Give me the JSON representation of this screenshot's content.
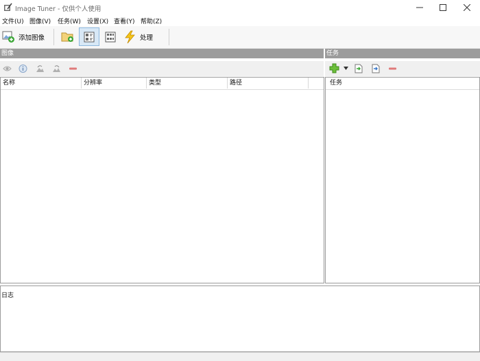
{
  "window": {
    "title": "Image Tuner - 仅供个人使用",
    "controls": [
      "minimize",
      "maximize",
      "close"
    ]
  },
  "menu": [
    "文件(U)",
    "图像(V)",
    "任务(W)",
    "设置(X)",
    "查看(Y)",
    "帮助(Z)"
  ],
  "toolbar": {
    "add_images_label": "添加图像",
    "add_folder_icon": "folder-add-icon",
    "view_details_icon": "view-details-icon",
    "view_thumbnails_icon": "view-thumbnails-icon",
    "process_label": "处理"
  },
  "images_panel": {
    "title": "图像",
    "tools": [
      "eye-icon",
      "info-icon",
      "rotate-left-icon",
      "rotate-right-icon",
      "remove-icon"
    ],
    "columns": [
      "名称",
      "分辨率",
      "类型",
      "路径"
    ]
  },
  "tasks_panel": {
    "title": "任务",
    "tools": [
      "add-task-icon",
      "dropdown-arrow-icon",
      "import-task-icon",
      "export-task-icon",
      "remove-task-icon"
    ],
    "column": "任务"
  },
  "log_panel": {
    "title": "日志"
  },
  "colors": {
    "panel_header_bg": "#9c9c9c",
    "selected_button_bg": "#d8e8f6",
    "accent_green": "#3aa635",
    "remove_red": "#e07a7a"
  }
}
